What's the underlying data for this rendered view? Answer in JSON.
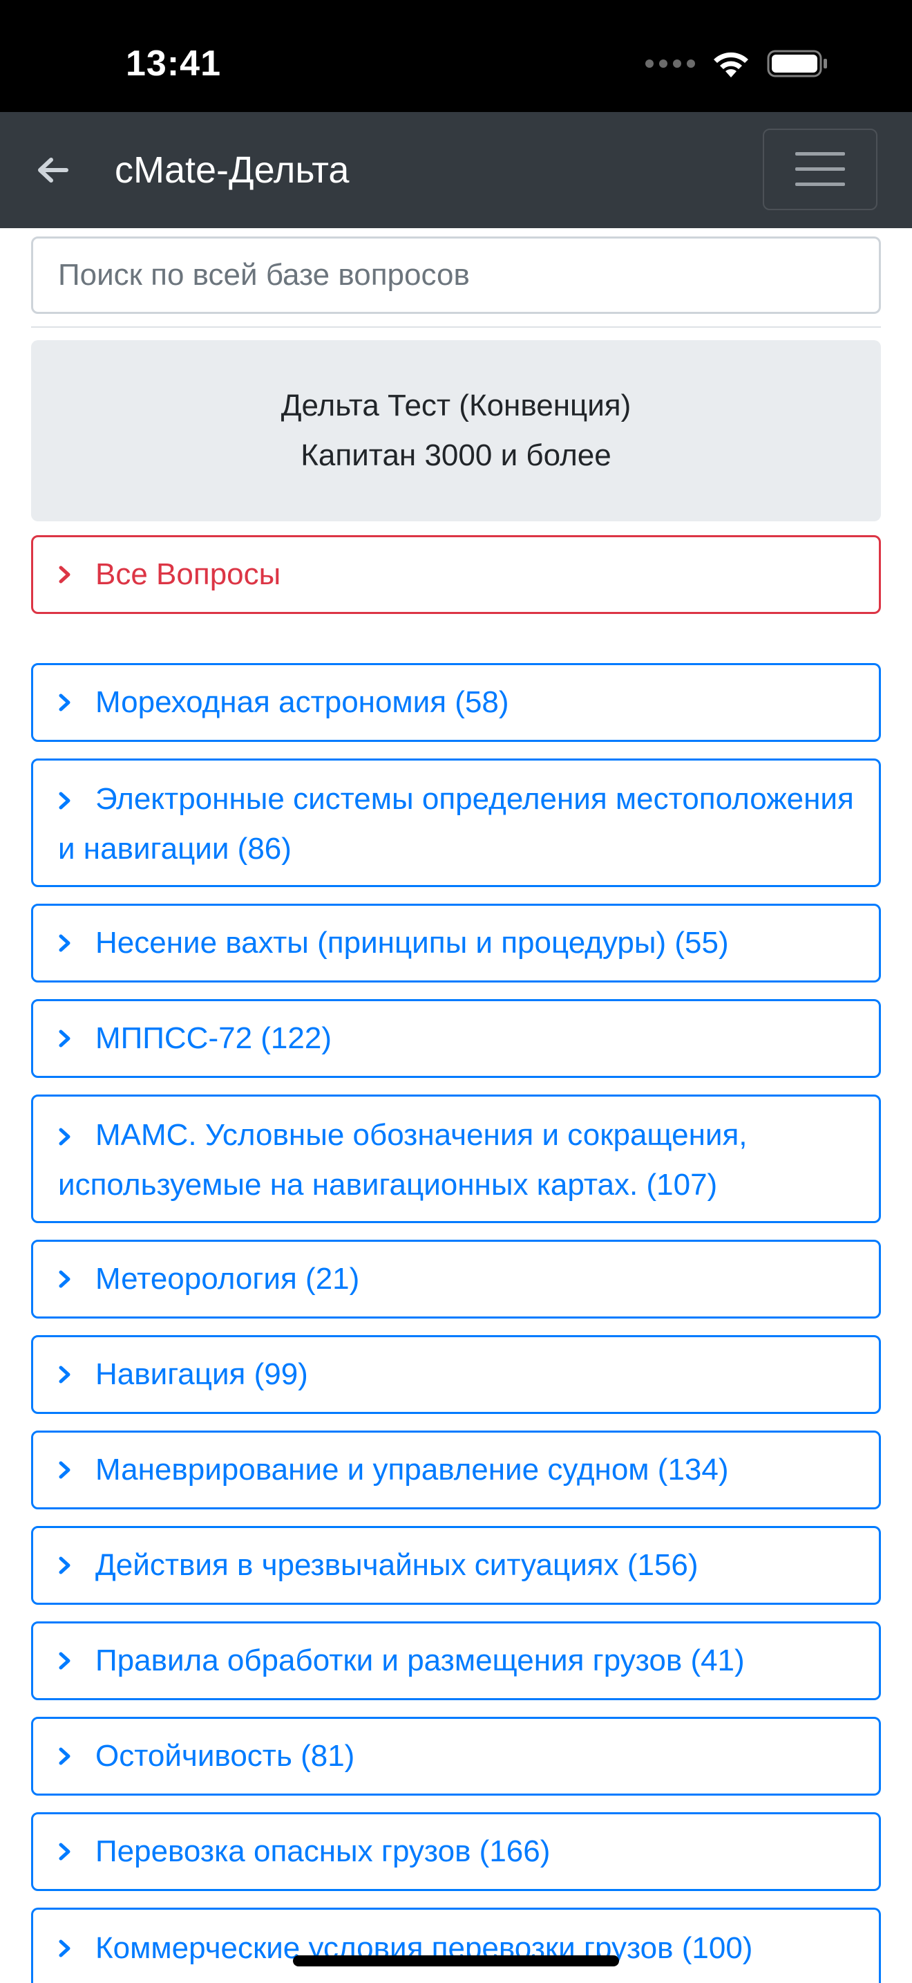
{
  "status": {
    "time": "13:41"
  },
  "header": {
    "title": "cMate-Дельта"
  },
  "search": {
    "placeholder": "Поиск по всей базе вопросов"
  },
  "info": {
    "line1": "Дельта Тест (Конвенция)",
    "line2": "Капитан 3000 и более"
  },
  "all_questions": {
    "label": "Все Вопросы"
  },
  "categories": [
    "Мореходная астрономия (58)",
    "Электронные системы определения местоположения и навигации (86)",
    "Несение вахты (принципы и процедуры) (55)",
    "МППСС-72 (122)",
    "МАМС. Условные обозначения и сокращения, используемые на навигационных картах. (107)",
    "Метеорология (21)",
    "Навигация (99)",
    "Маневрирование и управление судном (134)",
    "Действия в чрезвычайных ситуациях (156)",
    "Правила обработки и размещения грузов (41)",
    "Остойчивость (81)",
    "Перевозка опасных грузов (166)",
    "Коммерческие условия перевозки грузов (100)"
  ],
  "colors": {
    "accent": "#007bff",
    "danger": "#dc3545",
    "navbar": "#343a40",
    "card": "#e9ecef"
  }
}
